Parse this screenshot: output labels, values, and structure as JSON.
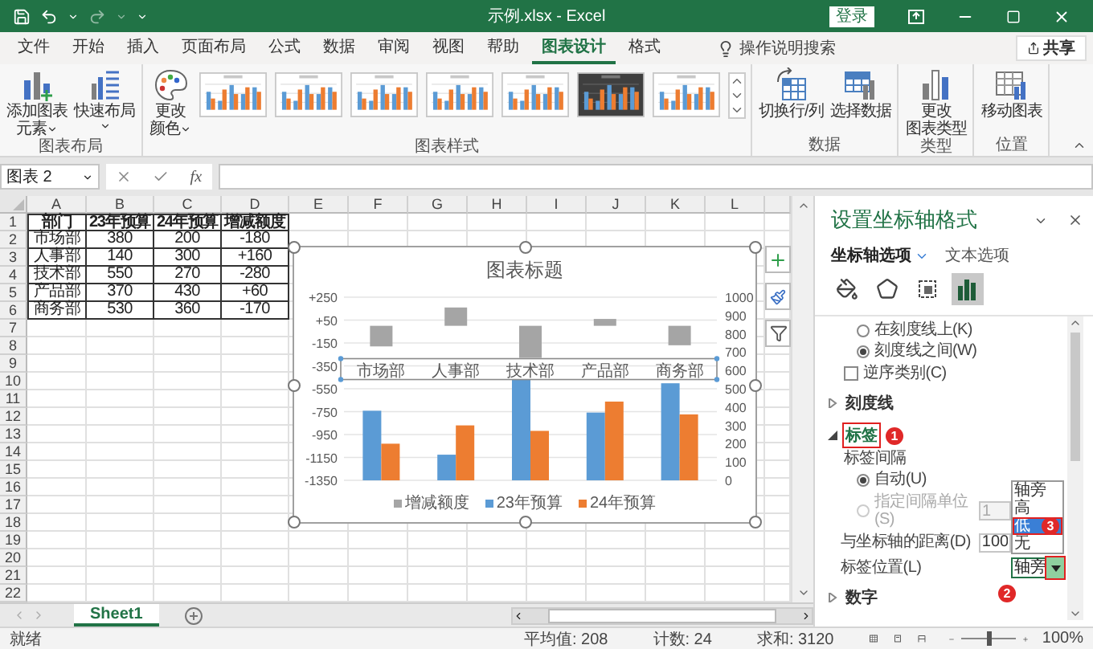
{
  "title_bar": {
    "title": "示例.xlsx - Excel",
    "sign_in": "登录"
  },
  "ribbon_tabs": [
    {
      "label": "文件",
      "selected": false
    },
    {
      "label": "开始",
      "selected": false
    },
    {
      "label": "插入",
      "selected": false
    },
    {
      "label": "页面布局",
      "selected": false
    },
    {
      "label": "公式",
      "selected": false
    },
    {
      "label": "数据",
      "selected": false
    },
    {
      "label": "审阅",
      "selected": false
    },
    {
      "label": "视图",
      "selected": false
    },
    {
      "label": "帮助",
      "selected": false
    },
    {
      "label": "图表设计",
      "selected": true
    },
    {
      "label": "格式",
      "selected": false
    }
  ],
  "tell_me": {
    "placeholder": "操作说明搜索"
  },
  "share_button": "共享",
  "ribbon_groups": [
    {
      "label": "图表布局",
      "buttons": [
        {
          "kind": "add",
          "lines": [
            "添加图表",
            "元素"
          ],
          "dropdown": true
        },
        {
          "kind": "layout",
          "lines": [
            "快速布局"
          ],
          "dropdown": true
        }
      ]
    },
    {
      "label": "图表样式",
      "buttons": [
        {
          "kind": "colors",
          "lines": [
            "更改",
            "颜色"
          ],
          "dropdown": true
        }
      ],
      "gallery": [
        {
          "kind": "light"
        },
        {
          "kind": "light"
        },
        {
          "kind": "light"
        },
        {
          "kind": "light"
        },
        {
          "kind": "light"
        },
        {
          "kind": "dark"
        },
        {
          "kind": "light"
        }
      ]
    },
    {
      "label": "数据",
      "buttons": [
        {
          "kind": "switch",
          "lines": [
            "切换行/列"
          ],
          "dropdown": false
        },
        {
          "kind": "select",
          "lines": [
            "选择数据"
          ],
          "dropdown": false
        }
      ]
    },
    {
      "label": "类型",
      "buttons": [
        {
          "kind": "type",
          "lines": [
            "更改",
            "图表类型"
          ],
          "dropdown": false
        }
      ]
    },
    {
      "label": "位置",
      "buttons": [
        {
          "kind": "move",
          "lines": [
            "移动图表"
          ],
          "dropdown": false
        }
      ]
    }
  ],
  "formula_bar": {
    "name_box": "图表 2",
    "function_label": "fx"
  },
  "sheet": {
    "columns": [
      "A",
      "B",
      "C",
      "D",
      "E",
      "F",
      "G",
      "H",
      "I",
      "J",
      "K",
      "L"
    ],
    "rows": [
      {
        "header": "1",
        "kind": "header",
        "cells": [
          "部门",
          "23年预算",
          "24年预算",
          "增减额度"
        ]
      },
      {
        "header": "2",
        "kind": "data",
        "cells": [
          "市场部",
          "380",
          "200",
          "-180"
        ]
      },
      {
        "header": "3",
        "kind": "data",
        "cells": [
          "人事部",
          "140",
          "300",
          "+160"
        ]
      },
      {
        "header": "4",
        "kind": "data",
        "cells": [
          "技术部",
          "550",
          "270",
          "-280"
        ]
      },
      {
        "header": "5",
        "kind": "data",
        "cells": [
          "产品部",
          "370",
          "430",
          "+60"
        ]
      },
      {
        "header": "6",
        "kind": "data",
        "cells": [
          "商务部",
          "530",
          "360",
          "-170"
        ]
      },
      {
        "header": "7"
      },
      {
        "header": "8"
      },
      {
        "header": "9"
      },
      {
        "header": "10"
      },
      {
        "header": "11"
      },
      {
        "header": "12"
      },
      {
        "header": "13"
      },
      {
        "header": "14"
      },
      {
        "header": "15"
      },
      {
        "header": "16"
      },
      {
        "header": "17"
      },
      {
        "header": "18"
      },
      {
        "header": "19"
      },
      {
        "header": "20"
      },
      {
        "header": "21"
      },
      {
        "header": "22"
      }
    ]
  },
  "chart": {
    "title": "图表标题",
    "selected": true,
    "chart_data": {
      "type": "bar",
      "categories": [
        "市场部",
        "人事部",
        "技术部",
        "产品部",
        "商务部"
      ],
      "stacked": false,
      "grid": true,
      "series": [
        {
          "name": "增减额度",
          "color": "#a5a5a5",
          "values": [
            -180,
            160,
            -280,
            60,
            -170
          ]
        },
        {
          "name": "23年预算",
          "color": "#5b9bd5",
          "axis": "y2",
          "values": [
            380,
            140,
            550,
            370,
            530
          ]
        },
        {
          "name": "24年预算",
          "color": "#ed7d31",
          "axis": "y2",
          "values": [
            200,
            300,
            270,
            430,
            360
          ]
        }
      ],
      "y2lim": [
        0,
        1000
      ],
      "ylim": [
        -1350,
        250
      ],
      "yticks": [
        {
          "value": 250,
          "label": "+250"
        },
        {
          "value": 50,
          "label": "+50"
        },
        {
          "value": -150,
          "label": "-150"
        },
        {
          "value": -350,
          "label": "-350"
        },
        {
          "value": -550,
          "label": "-550"
        },
        {
          "value": -750,
          "label": "-750"
        },
        {
          "value": -950,
          "label": "-950"
        },
        {
          "value": -1150,
          "label": "-1150"
        },
        {
          "value": -1350,
          "label": "-1350"
        }
      ],
      "y2ticks": [
        0,
        100,
        200,
        300,
        400,
        500,
        600,
        700,
        800,
        900,
        1000
      ]
    }
  },
  "format_pane": {
    "title": "设置坐标轴格式",
    "tabs": [
      {
        "label": "坐标轴选项",
        "selected": true
      },
      {
        "label": "文本选项",
        "selected": false
      }
    ],
    "icon_tabs": [
      {
        "kind": "fill",
        "selected": false
      },
      {
        "kind": "effects",
        "selected": false
      },
      {
        "kind": "size",
        "selected": false
      },
      {
        "kind": "options",
        "selected": true
      }
    ],
    "items": [
      {
        "kind": "radio",
        "label": "在刻度线上(K)",
        "selected": false
      },
      {
        "kind": "radio",
        "label": "刻度线之间(W)",
        "selected": true
      },
      {
        "kind": "checkbox",
        "label": "逆序类别(C)",
        "checked": false
      },
      {
        "kind": "section",
        "label": "刻度线",
        "expanded": false
      },
      {
        "kind": "section",
        "label": "标签",
        "expanded": true,
        "callout": "1"
      },
      {
        "kind": "caption",
        "label": "标签间隔"
      },
      {
        "kind": "radio",
        "label": "自动(U)",
        "selected": true
      },
      {
        "kind": "radio",
        "label": "指定间隔单位(S)",
        "selected": false,
        "disabled": true,
        "value": "1"
      },
      {
        "kind": "field",
        "label": "与坐标轴的距离(D)",
        "value": "100"
      },
      {
        "kind": "select",
        "label": "标签位置(L)",
        "value": "轴旁",
        "callout": "2",
        "expanded": true,
        "options": [
          {
            "label": "轴旁",
            "highlighted": false
          },
          {
            "label": "高",
            "highlighted": false
          },
          {
            "label": "低",
            "highlighted": true,
            "callout": "3"
          },
          {
            "label": "无",
            "highlighted": false
          }
        ]
      },
      {
        "kind": "section",
        "label": "数字",
        "expanded": false
      }
    ]
  },
  "sheet_tabs": [
    {
      "label": "Sheet1",
      "selected": true
    }
  ],
  "status_bar": {
    "status": "就绪",
    "stats": [
      "平均值: 208",
      "计数: 24",
      "求和: 3120"
    ],
    "zoom": "100%",
    "zoom_slider": {
      "level": 0.5
    }
  }
}
